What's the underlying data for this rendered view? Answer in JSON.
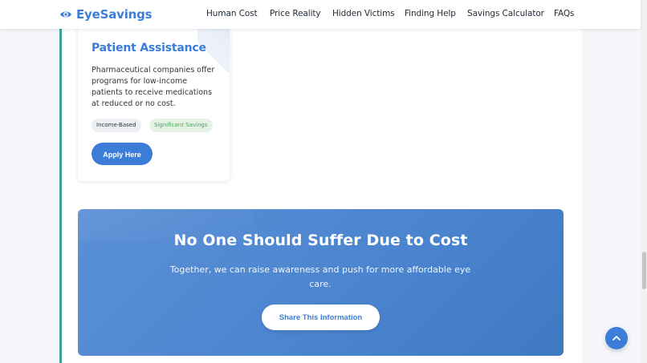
{
  "brand": {
    "name": "EyeSavings",
    "icon": "eye-icon",
    "color": "#3b7dd8"
  },
  "nav": {
    "items": [
      {
        "label": "Human Cost"
      },
      {
        "label": "Price Reality"
      },
      {
        "label": "Hidden Victims"
      },
      {
        "label": "Finding Help"
      },
      {
        "label": "Savings Calculator"
      },
      {
        "label": "FAQs"
      }
    ]
  },
  "card": {
    "title": "Patient Assistance",
    "description": "Pharmaceutical companies offer programs for low-income patients to receive medications at reduced or no cost.",
    "tags": [
      "Income-Based",
      "Significant Savings"
    ],
    "button": "Apply Here"
  },
  "cta": {
    "title": "No One Should Suffer Due to Cost",
    "text": "Together, we can raise awareness and push for more affordable eye care.",
    "button": "Share This Information"
  },
  "scroll_top": {
    "icon": "chevron-up-icon"
  },
  "colors": {
    "accent": "#3b7dd8",
    "rail": "#3aa39a",
    "savings_tag": "#49a35a"
  }
}
